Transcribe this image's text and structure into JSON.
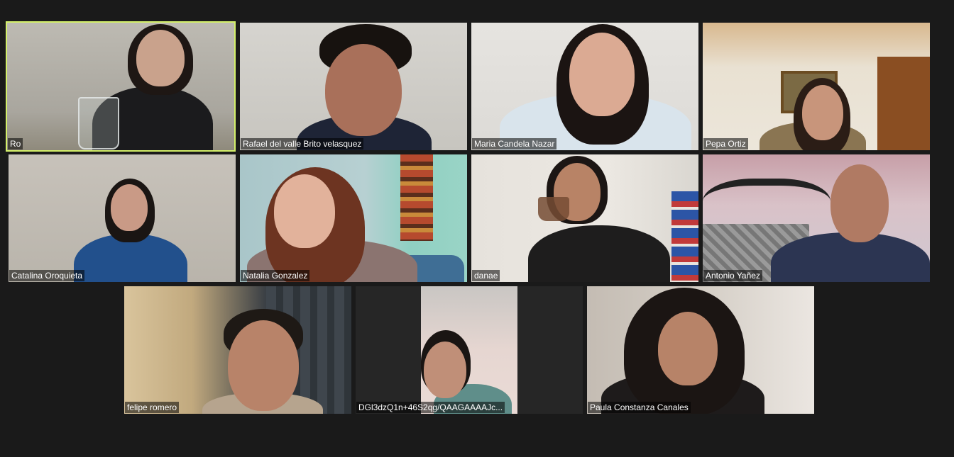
{
  "participants": [
    {
      "name": "Ro",
      "active": true
    },
    {
      "name": "Rafael del valle Brito velasquez",
      "active": false
    },
    {
      "name": "Maria Candela Nazar",
      "active": false
    },
    {
      "name": "Pepa Ortiz",
      "active": false
    },
    {
      "name": "Catalina Oroquieta",
      "active": false
    },
    {
      "name": "Natalia Gonzalez",
      "active": false
    },
    {
      "name": "danae",
      "active": false
    },
    {
      "name": "Antonio Yañez",
      "active": false
    },
    {
      "name": "felipe romero",
      "active": false
    },
    {
      "name": "DGl3dzQ1n+46S2qg/QAAGAAAAJc...",
      "active": false
    },
    {
      "name": "Paula Constanza Canales",
      "active": false
    }
  ],
  "colors": {
    "background": "#1a1a1a",
    "active_speaker_border": "#d4f06a",
    "name_tag_bg": "rgba(0,0,0,0.55)",
    "name_tag_text": "#ffffff"
  }
}
